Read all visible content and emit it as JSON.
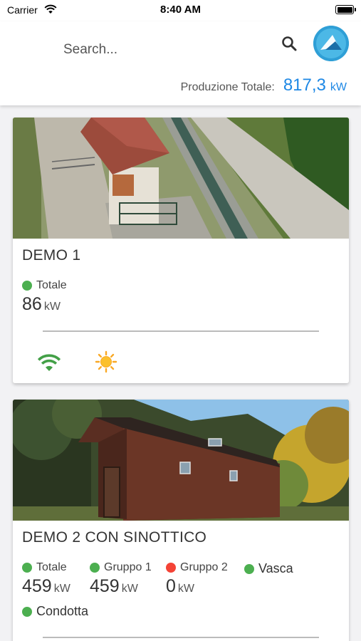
{
  "status_bar": {
    "carrier": "Carrier",
    "time": "8:40 AM"
  },
  "header": {
    "search_placeholder": "Search...",
    "production_label": "Produzione Totale:",
    "production_value": "817,3",
    "production_unit": "kW"
  },
  "colors": {
    "accent": "#1e88e5",
    "status_ok": "#4caf50",
    "status_error": "#f44336",
    "wifi": "#43a047",
    "sun": "#f9a825"
  },
  "plants": [
    {
      "title": "DEMO 1",
      "metrics": [
        {
          "name": "Totale",
          "value": "86",
          "unit": "kW",
          "status": "ok"
        }
      ],
      "icons": [
        "wifi-icon",
        "sun-icon"
      ]
    },
    {
      "title": "DEMO 2 CON SINOTTICO",
      "metrics": [
        {
          "name": "Totale",
          "value": "459",
          "unit": "kW",
          "status": "ok"
        },
        {
          "name": "Gruppo 1",
          "value": "459",
          "unit": "kW",
          "status": "ok"
        },
        {
          "name": "Gruppo 2",
          "value": "0",
          "unit": "kW",
          "status": "error"
        },
        {
          "name": "Vasca",
          "status": "ok"
        },
        {
          "name": "Condotta",
          "status": "ok"
        }
      ]
    }
  ]
}
